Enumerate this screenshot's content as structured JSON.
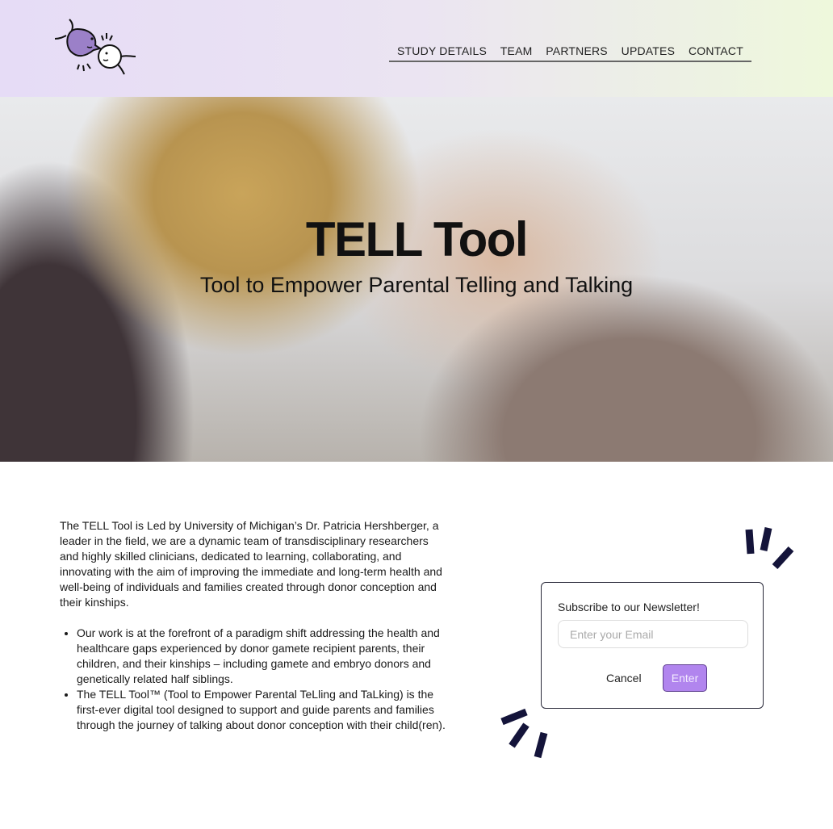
{
  "header": {
    "nav": [
      "STUDY DETAILS",
      "TEAM",
      "PARTNERS",
      "UPDATES",
      "CONTACT"
    ]
  },
  "hero": {
    "title": "TELL Tool",
    "subtitle": "Tool to Empower Parental Telling and Talking"
  },
  "content": {
    "intro": "The TELL Tool is Led by University of Michigan’s Dr. Patricia Hershberger, a leader in the field, we are a dynamic team of transdisciplinary researchers and highly skilled clinicians, dedicated to learning, collaborating, and innovating with the aim of improving the immediate and long-term health and well-being of individuals and families created through donor conception and their kinships.",
    "bullets": [
      "Our work is at the forefront of a paradigm shift addressing the health and healthcare gaps experienced by donor gamete recipient parents, their children, and their kinships – including gamete and embryo donors and genetically related half siblings.",
      "The TELL Tool™ (Tool to Empower Parental TeLling and TaLking) is the first-ever digital tool designed to support and guide parents and families through the journey of talking about donor conception with their child(ren)."
    ]
  },
  "newsletter": {
    "title": "Subscribe to our Newsletter!",
    "placeholder": "Enter your Email",
    "cancel": "Cancel",
    "enter": "Enter"
  },
  "colors": {
    "accent": "#b185ee",
    "dark": "#14143a"
  }
}
